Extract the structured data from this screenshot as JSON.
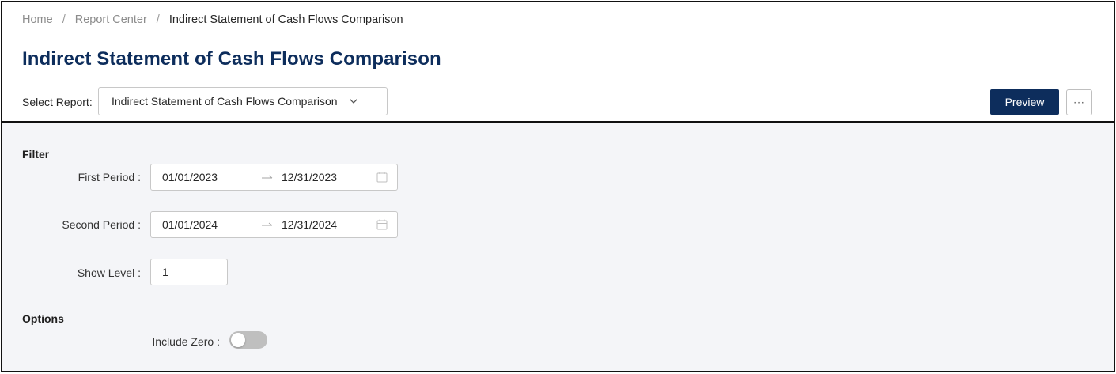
{
  "breadcrumb": {
    "items": [
      "Home",
      "Report Center",
      "Indirect Statement of Cash Flows Comparison"
    ],
    "separator": "/"
  },
  "page_title": "Indirect Statement of Cash Flows Comparison",
  "report_selector": {
    "label": "Select Report:",
    "value": "Indirect Statement of Cash Flows Comparison"
  },
  "toolbar": {
    "preview_label": "Preview",
    "more_label": "···"
  },
  "filter": {
    "section_label": "Filter",
    "first_period": {
      "label": "First Period :",
      "start": "01/01/2023",
      "end": "12/31/2023"
    },
    "second_period": {
      "label": "Second Period :",
      "start": "01/01/2024",
      "end": "12/31/2024"
    },
    "show_level": {
      "label": "Show Level :",
      "value": "1"
    }
  },
  "options": {
    "section_label": "Options",
    "include_zero": {
      "label": "Include Zero :",
      "checked": false
    }
  },
  "colors": {
    "brand": "#0d2d5c",
    "panel_bg": "#f4f5f8",
    "toggle_off": "#bfbfbf"
  },
  "icons": {
    "select_chevron": "chevron-down-icon",
    "range_separator": "arrow-right-icon",
    "date_picker": "calendar-icon"
  }
}
